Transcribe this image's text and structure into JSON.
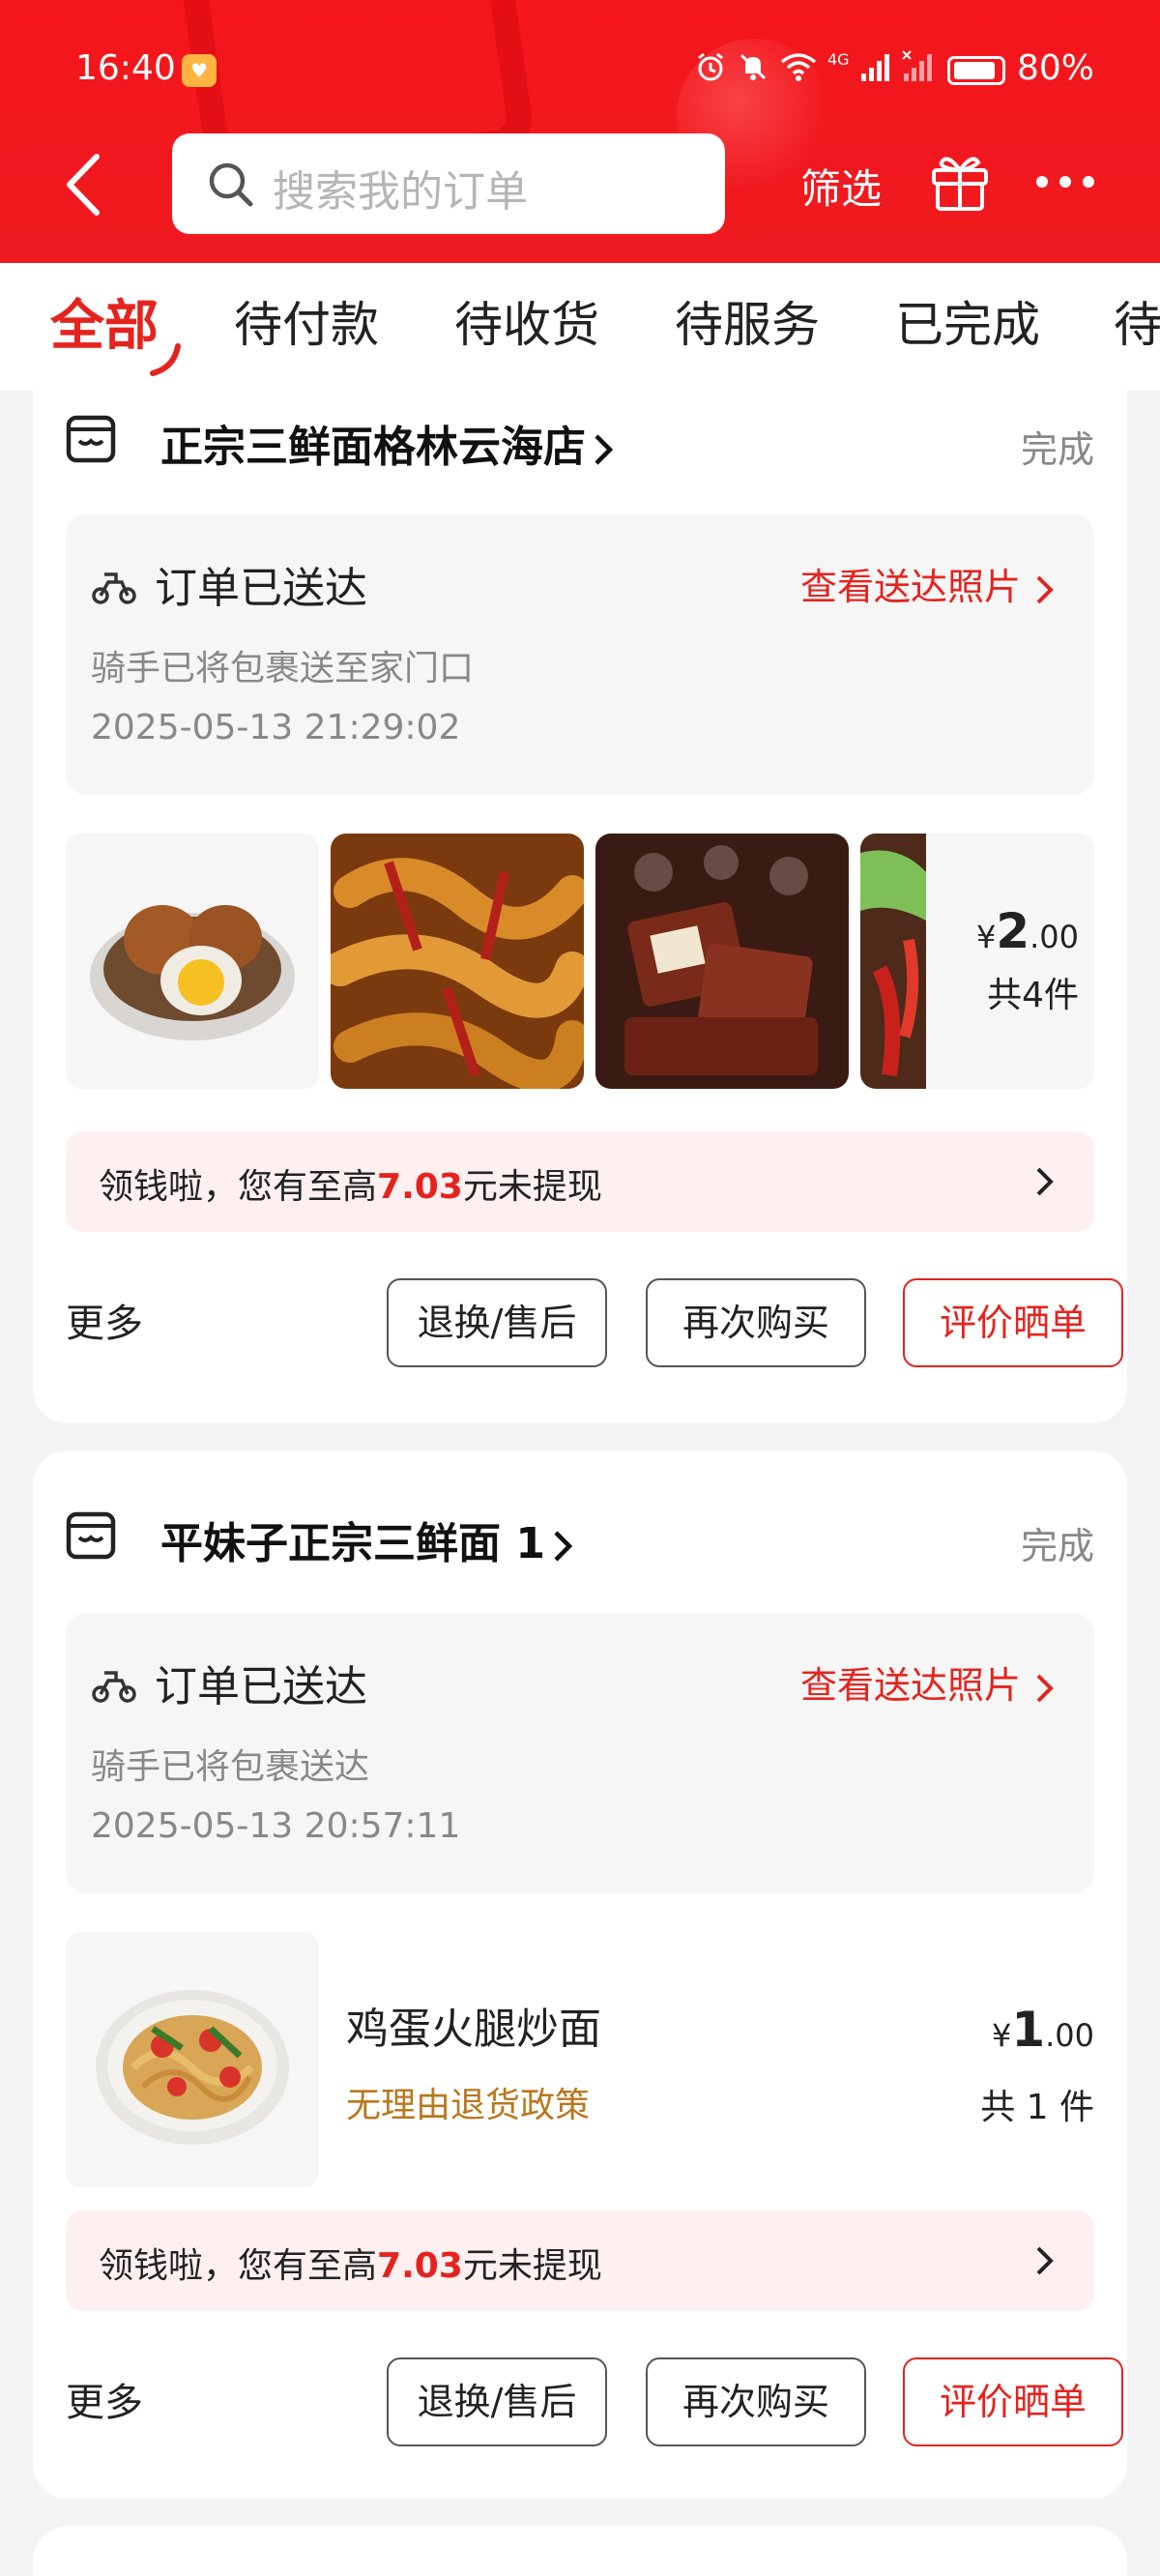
{
  "status_bar": {
    "time": "16:40",
    "network": "4G",
    "battery": "80%"
  },
  "header": {
    "search_placeholder": "搜索我的订单",
    "filter_label": "筛选"
  },
  "tabs": [
    {
      "label": "全部",
      "active": true
    },
    {
      "label": "待付款"
    },
    {
      "label": "待收货"
    },
    {
      "label": "待服务"
    },
    {
      "label": "已完成"
    },
    {
      "label": "待"
    }
  ],
  "orders": [
    {
      "shop_name": "正宗三鲜面格林云海店",
      "status": "完成",
      "delivery": {
        "title": "订单已送达",
        "link": "查看送达照片",
        "subtitle": "骑手已将包裹送至家门口",
        "time": "2025-05-13 21:29:02"
      },
      "thumbnails": [
        "braised-eggs",
        "spicy-chicken-feet",
        "braised-tofu",
        "spicy-beef-slices"
      ],
      "price_symbol": "¥",
      "price_int": "2",
      "price_dec": ".00",
      "count": "共4件",
      "promo": {
        "prefix": "领钱啦，您有至高",
        "amount": "7.03",
        "suffix": "元未提现"
      },
      "more": "更多",
      "buttons": [
        "退换/售后",
        "再次购买",
        "评价晒单"
      ]
    },
    {
      "shop_name": "平妹子正宗三鲜面 1",
      "status": "完成",
      "delivery": {
        "title": "订单已送达",
        "link": "查看送达照片",
        "subtitle": "骑手已将包裹送达",
        "time": "2025-05-13 20:57:11"
      },
      "item": {
        "name": "鸡蛋火腿炒面",
        "policy": "无理由退货政策"
      },
      "price_symbol": "¥",
      "price_int": "1",
      "price_dec": ".00",
      "count": "共 1 件",
      "promo": {
        "prefix": "领钱啦，您有至高",
        "amount": "7.03",
        "suffix": "元未提现"
      },
      "more": "更多",
      "buttons": [
        "退换/售后",
        "再次购买",
        "评价晒单"
      ]
    }
  ],
  "colors": {
    "brand_red": "#e5231e",
    "header_red": "#f4161c",
    "policy_gold": "#b8781e"
  }
}
